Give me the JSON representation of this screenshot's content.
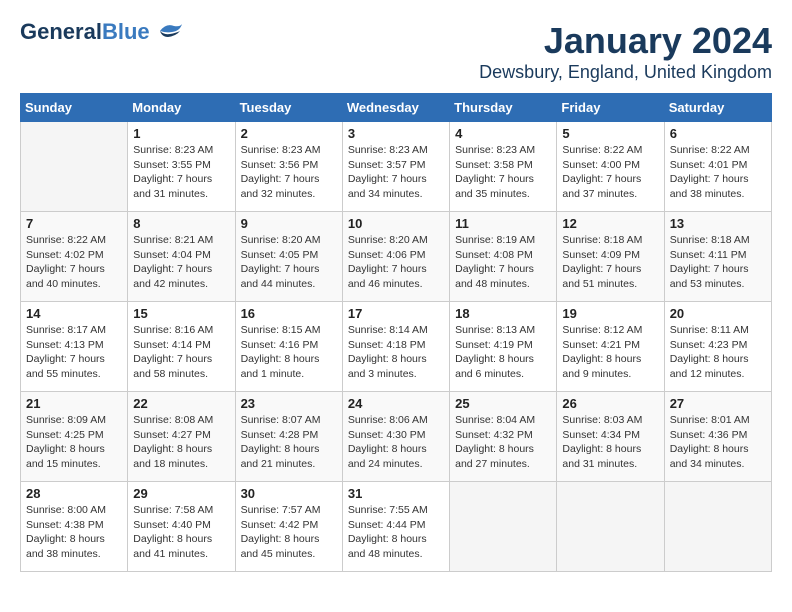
{
  "logo": {
    "part1": "General",
    "part2": "Blue"
  },
  "title": {
    "month": "January 2024",
    "location": "Dewsbury, England, United Kingdom"
  },
  "headers": [
    "Sunday",
    "Monday",
    "Tuesday",
    "Wednesday",
    "Thursday",
    "Friday",
    "Saturday"
  ],
  "weeks": [
    [
      {
        "day": "",
        "info": ""
      },
      {
        "day": "1",
        "info": "Sunrise: 8:23 AM\nSunset: 3:55 PM\nDaylight: 7 hours\nand 31 minutes."
      },
      {
        "day": "2",
        "info": "Sunrise: 8:23 AM\nSunset: 3:56 PM\nDaylight: 7 hours\nand 32 minutes."
      },
      {
        "day": "3",
        "info": "Sunrise: 8:23 AM\nSunset: 3:57 PM\nDaylight: 7 hours\nand 34 minutes."
      },
      {
        "day": "4",
        "info": "Sunrise: 8:23 AM\nSunset: 3:58 PM\nDaylight: 7 hours\nand 35 minutes."
      },
      {
        "day": "5",
        "info": "Sunrise: 8:22 AM\nSunset: 4:00 PM\nDaylight: 7 hours\nand 37 minutes."
      },
      {
        "day": "6",
        "info": "Sunrise: 8:22 AM\nSunset: 4:01 PM\nDaylight: 7 hours\nand 38 minutes."
      }
    ],
    [
      {
        "day": "7",
        "info": "Sunrise: 8:22 AM\nSunset: 4:02 PM\nDaylight: 7 hours\nand 40 minutes."
      },
      {
        "day": "8",
        "info": "Sunrise: 8:21 AM\nSunset: 4:04 PM\nDaylight: 7 hours\nand 42 minutes."
      },
      {
        "day": "9",
        "info": "Sunrise: 8:20 AM\nSunset: 4:05 PM\nDaylight: 7 hours\nand 44 minutes."
      },
      {
        "day": "10",
        "info": "Sunrise: 8:20 AM\nSunset: 4:06 PM\nDaylight: 7 hours\nand 46 minutes."
      },
      {
        "day": "11",
        "info": "Sunrise: 8:19 AM\nSunset: 4:08 PM\nDaylight: 7 hours\nand 48 minutes."
      },
      {
        "day": "12",
        "info": "Sunrise: 8:18 AM\nSunset: 4:09 PM\nDaylight: 7 hours\nand 51 minutes."
      },
      {
        "day": "13",
        "info": "Sunrise: 8:18 AM\nSunset: 4:11 PM\nDaylight: 7 hours\nand 53 minutes."
      }
    ],
    [
      {
        "day": "14",
        "info": "Sunrise: 8:17 AM\nSunset: 4:13 PM\nDaylight: 7 hours\nand 55 minutes."
      },
      {
        "day": "15",
        "info": "Sunrise: 8:16 AM\nSunset: 4:14 PM\nDaylight: 7 hours\nand 58 minutes."
      },
      {
        "day": "16",
        "info": "Sunrise: 8:15 AM\nSunset: 4:16 PM\nDaylight: 8 hours\nand 1 minute."
      },
      {
        "day": "17",
        "info": "Sunrise: 8:14 AM\nSunset: 4:18 PM\nDaylight: 8 hours\nand 3 minutes."
      },
      {
        "day": "18",
        "info": "Sunrise: 8:13 AM\nSunset: 4:19 PM\nDaylight: 8 hours\nand 6 minutes."
      },
      {
        "day": "19",
        "info": "Sunrise: 8:12 AM\nSunset: 4:21 PM\nDaylight: 8 hours\nand 9 minutes."
      },
      {
        "day": "20",
        "info": "Sunrise: 8:11 AM\nSunset: 4:23 PM\nDaylight: 8 hours\nand 12 minutes."
      }
    ],
    [
      {
        "day": "21",
        "info": "Sunrise: 8:09 AM\nSunset: 4:25 PM\nDaylight: 8 hours\nand 15 minutes."
      },
      {
        "day": "22",
        "info": "Sunrise: 8:08 AM\nSunset: 4:27 PM\nDaylight: 8 hours\nand 18 minutes."
      },
      {
        "day": "23",
        "info": "Sunrise: 8:07 AM\nSunset: 4:28 PM\nDaylight: 8 hours\nand 21 minutes."
      },
      {
        "day": "24",
        "info": "Sunrise: 8:06 AM\nSunset: 4:30 PM\nDaylight: 8 hours\nand 24 minutes."
      },
      {
        "day": "25",
        "info": "Sunrise: 8:04 AM\nSunset: 4:32 PM\nDaylight: 8 hours\nand 27 minutes."
      },
      {
        "day": "26",
        "info": "Sunrise: 8:03 AM\nSunset: 4:34 PM\nDaylight: 8 hours\nand 31 minutes."
      },
      {
        "day": "27",
        "info": "Sunrise: 8:01 AM\nSunset: 4:36 PM\nDaylight: 8 hours\nand 34 minutes."
      }
    ],
    [
      {
        "day": "28",
        "info": "Sunrise: 8:00 AM\nSunset: 4:38 PM\nDaylight: 8 hours\nand 38 minutes."
      },
      {
        "day": "29",
        "info": "Sunrise: 7:58 AM\nSunset: 4:40 PM\nDaylight: 8 hours\nand 41 minutes."
      },
      {
        "day": "30",
        "info": "Sunrise: 7:57 AM\nSunset: 4:42 PM\nDaylight: 8 hours\nand 45 minutes."
      },
      {
        "day": "31",
        "info": "Sunrise: 7:55 AM\nSunset: 4:44 PM\nDaylight: 8 hours\nand 48 minutes."
      },
      {
        "day": "",
        "info": ""
      },
      {
        "day": "",
        "info": ""
      },
      {
        "day": "",
        "info": ""
      }
    ]
  ]
}
